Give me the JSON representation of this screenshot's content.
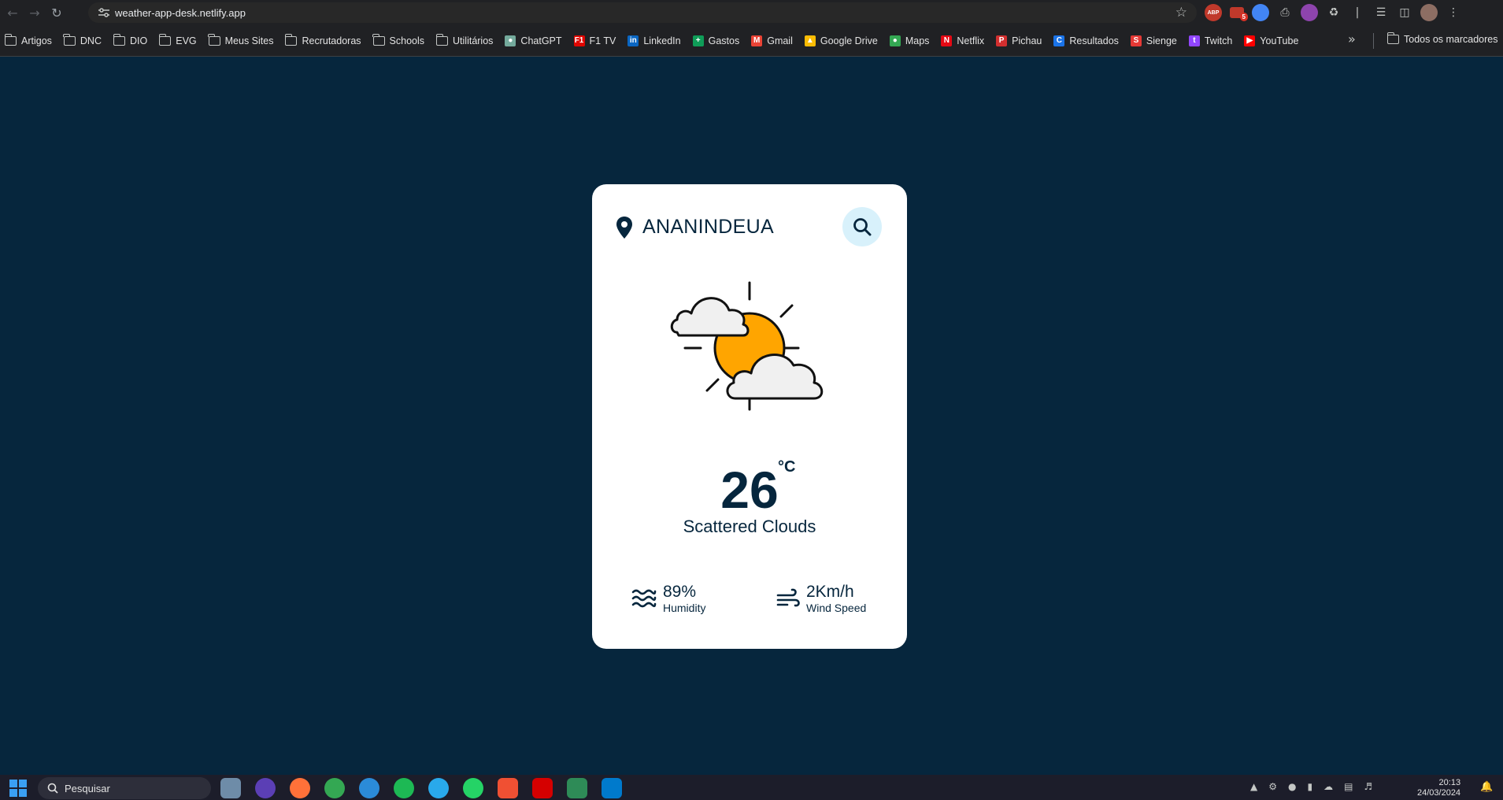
{
  "browser": {
    "url": "weather-app-desk.netlify.app",
    "extension_badge": "5",
    "extension_abp": "ABP"
  },
  "bookmarks": [
    {
      "label": "Artigos",
      "icon": "folder-icon"
    },
    {
      "label": "DNC",
      "icon": "folder-icon"
    },
    {
      "label": "DIO",
      "icon": "folder-icon"
    },
    {
      "label": "EVG",
      "icon": "folder-icon"
    },
    {
      "label": "Meus Sites",
      "icon": "folder-icon"
    },
    {
      "label": "Recrutadoras",
      "icon": "folder-icon"
    },
    {
      "label": "Schools",
      "icon": "folder-icon"
    },
    {
      "label": "Utilitários",
      "icon": "folder-icon"
    },
    {
      "label": "ChatGPT",
      "icon": "chatgpt-icon"
    },
    {
      "label": "F1 TV",
      "icon": "f1-icon"
    },
    {
      "label": "LinkedIn",
      "icon": "linkedin-icon"
    },
    {
      "label": "Gastos",
      "icon": "sheets-icon"
    },
    {
      "label": "Gmail",
      "icon": "gmail-icon"
    },
    {
      "label": "Google Drive",
      "icon": "drive-icon"
    },
    {
      "label": "Maps",
      "icon": "maps-icon"
    },
    {
      "label": "Netflix",
      "icon": "netflix-icon"
    },
    {
      "label": "Pichau",
      "icon": "pichau-icon"
    },
    {
      "label": "Resultados",
      "icon": "resultados-icon"
    },
    {
      "label": "Sienge",
      "icon": "sienge-icon"
    },
    {
      "label": "Twitch",
      "icon": "twitch-icon"
    },
    {
      "label": "YouTube",
      "icon": "youtube-icon"
    }
  ],
  "bookmarks_all_label": "Todos os marcadores",
  "weather": {
    "city": "ANANINDEUA",
    "temperature": "26",
    "unit": "°C",
    "description": "Scattered Clouds",
    "humidity_value": "89%",
    "humidity_label": "Humidity",
    "wind_value": "2Km/h",
    "wind_label": "Wind Speed",
    "icon": "scattered-clouds-icon"
  },
  "taskbar": {
    "search_placeholder": "Pesquisar",
    "time": "20:13",
    "date": "24/03/2024"
  },
  "colors": {
    "page_bg": "#06263d",
    "card_bg": "#ffffff",
    "text": "#06263d",
    "search_button_bg": "#d8f1fb",
    "sun": "#ffa500",
    "cloud": "#f0f0f0"
  }
}
